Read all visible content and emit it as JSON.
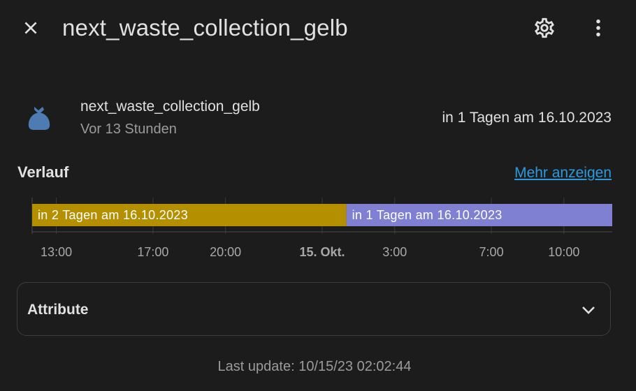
{
  "header": {
    "title": "next_waste_collection_gelb",
    "close_icon": "close-icon",
    "settings_icon": "gear-icon",
    "menu_icon": "more-vertical-icon"
  },
  "entity": {
    "icon": "trash-bag-icon",
    "icon_color": "#4f7bb3",
    "name": "next_waste_collection_gelb",
    "secondary": "Vor 13 Stunden",
    "state": "in 1 Tagen am 16.10.2023"
  },
  "history": {
    "title": "Verlauf",
    "more_link": "Mehr anzeigen"
  },
  "chart_data": {
    "type": "timeline",
    "segments": [
      {
        "label": "in 2 Tagen am 16.10.2023",
        "start": "2023-10-14 12:00",
        "end": "2023-10-15 01:00",
        "color": "#b48f00",
        "text_color": "#ffffff"
      },
      {
        "label": "in 1 Tagen am 16.10.2023",
        "start": "2023-10-15 01:00",
        "end": "2023-10-15 12:00",
        "color": "#7f80d2",
        "text_color": "#ffffff"
      }
    ],
    "ticks": [
      {
        "label": "13:00",
        "time": "2023-10-14 13:00",
        "bold": false
      },
      {
        "label": "17:00",
        "time": "2023-10-14 17:00",
        "bold": false
      },
      {
        "label": "20:00",
        "time": "2023-10-14 20:00",
        "bold": false
      },
      {
        "label": "15. Okt.",
        "time": "2023-10-15 00:00",
        "bold": true
      },
      {
        "label": "3:00",
        "time": "2023-10-15 03:00",
        "bold": false
      },
      {
        "label": "7:00",
        "time": "2023-10-15 07:00",
        "bold": false
      },
      {
        "label": "10:00",
        "time": "2023-10-15 10:00",
        "bold": false
      }
    ]
  },
  "attributes": {
    "label": "Attribute",
    "chevron_icon": "chevron-down-icon"
  },
  "footer": {
    "last_update": "Last update: 10/15/23 02:02:44"
  }
}
